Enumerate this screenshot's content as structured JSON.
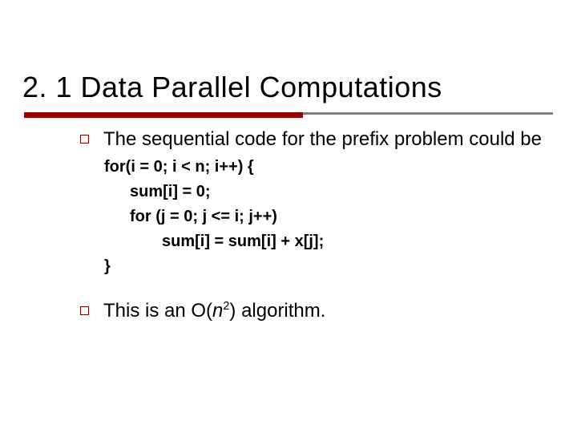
{
  "title": "2. 1 Data Parallel Computations",
  "bullets": {
    "b1": "The sequential code for the prefix problem could be",
    "b2_pre": "This is an O(",
    "b2_var": "n",
    "b2_exp": "2",
    "b2_post": ") algorithm."
  },
  "code": {
    "l1": "for(i = 0; i < n; i++) {",
    "l2": "sum[i] = 0;",
    "l3": "for (j = 0; j <= i; j++)",
    "l4": "sum[i] = sum[i] + x[j];",
    "l5": "}"
  }
}
